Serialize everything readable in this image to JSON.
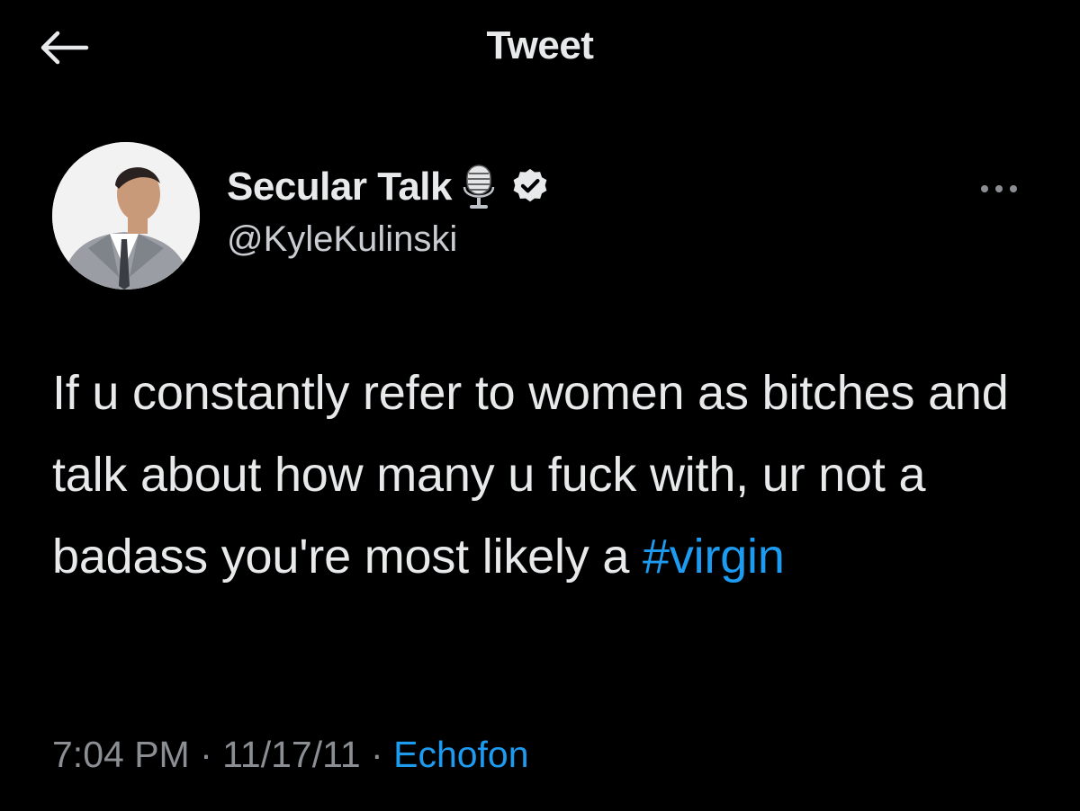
{
  "header": {
    "title": "Tweet",
    "back_icon": "arrow-left-icon"
  },
  "tweet": {
    "author": {
      "display_name": "Secular Talk",
      "handle": "@KyleKulinski",
      "badges": [
        "microphone-icon",
        "verified-badge-icon"
      ]
    },
    "text_before_hashtag": "If u constantly refer to women as bitches and talk about how many u fuck with, ur not a badass you're most likely a ",
    "hashtag": "#virgin",
    "time": "7:04 PM",
    "date": "11/17/11",
    "separator": " · ",
    "source": "Echofon",
    "more_icon": "more-horizontal-icon"
  },
  "colors": {
    "background": "#000000",
    "text": "#e7e9ea",
    "muted": "#8b8f94",
    "accent": "#1d9bf0"
  }
}
